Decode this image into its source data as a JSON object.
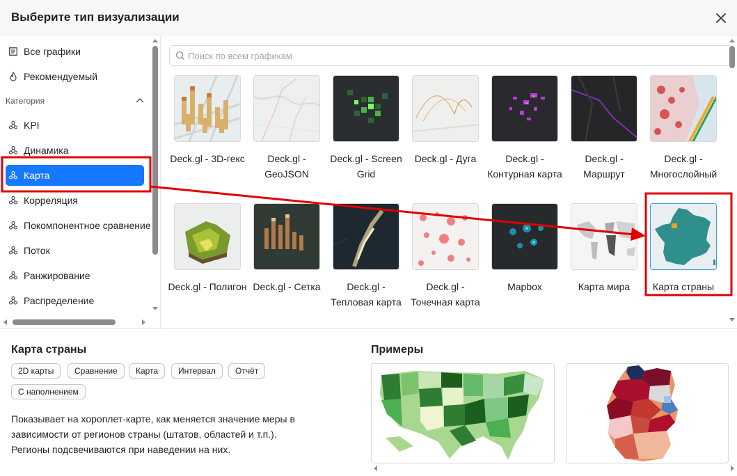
{
  "dialog": {
    "title": "Выберите тип визуализации"
  },
  "sidebar": {
    "top_items": [
      {
        "label": "Все графики",
        "icon": "chart-list-icon"
      },
      {
        "label": "Рекомендуемый",
        "icon": "fire-icon"
      }
    ],
    "category_label": "Категория",
    "categories": [
      {
        "label": "KPI",
        "icon": "category-icon"
      },
      {
        "label": "Динамика",
        "icon": "category-icon"
      },
      {
        "label": "Карта",
        "icon": "category-icon",
        "active": true
      },
      {
        "label": "Корреляция",
        "icon": "category-icon"
      },
      {
        "label": "Покомпонентное сравнение",
        "icon": "category-icon"
      },
      {
        "label": "Поток",
        "icon": "category-icon"
      },
      {
        "label": "Ранжирование",
        "icon": "category-icon"
      },
      {
        "label": "Распределение",
        "icon": "category-icon"
      }
    ]
  },
  "search": {
    "placeholder": "Поиск по всем графикам",
    "value": ""
  },
  "charts": [
    {
      "label": "Deck.gl - 3D-гекс"
    },
    {
      "label": "Deck.gl - GeoJSON"
    },
    {
      "label": "Deck.gl - Screen Grid"
    },
    {
      "label": "Deck.gl - Дуга"
    },
    {
      "label": "Deck.gl - Контурная карта"
    },
    {
      "label": "Deck.gl - Маршрут"
    },
    {
      "label": "Deck.gl - Многослойный"
    },
    {
      "label": "Deck.gl - Полигон"
    },
    {
      "label": "Deck.gl - Сетка"
    },
    {
      "label": "Deck.gl - Тепловая карта"
    },
    {
      "label": "Deck.gl - Точечная карта"
    },
    {
      "label": "Mapbox"
    },
    {
      "label": "Карта мира"
    },
    {
      "label": "Карта страны",
      "selected": true
    }
  ],
  "detail": {
    "title": "Карта страны",
    "tags": [
      "2D карты",
      "Сравнение",
      "Карта",
      "Интервал",
      "Отчёт",
      "С наполнением"
    ],
    "description": "Показывает на хороплет-карте, как меняется значение меры в зависимости от регионов страны (штатов, областей и т.п.). Регионы подсвечиваются при наведении на них.",
    "examples_title": "Примеры"
  },
  "colors": {
    "accent": "#1677ff",
    "annotation": "#e00000",
    "selected_border": "#4096ff"
  }
}
